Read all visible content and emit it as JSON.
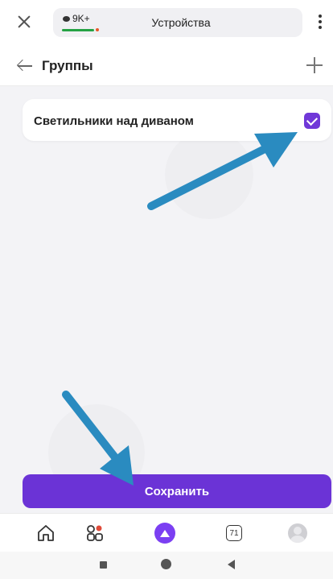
{
  "browser_bar": {
    "message_count": "9K+",
    "tab_title": "Устройства"
  },
  "header": {
    "title": "Группы"
  },
  "groups": [
    {
      "label": "Светильники над диваном",
      "checked": true
    }
  ],
  "actions": {
    "save_label": "Сохранить"
  },
  "bottom_nav": {
    "items": [
      {
        "icon": "home-icon"
      },
      {
        "icon": "services-icon"
      },
      {
        "icon": "alice-icon"
      },
      {
        "icon": "counter-icon",
        "label": "71"
      },
      {
        "icon": "avatar-icon"
      }
    ]
  },
  "colors": {
    "accent": "#6b33d6",
    "annotation_arrow": "#2a8bc0"
  }
}
